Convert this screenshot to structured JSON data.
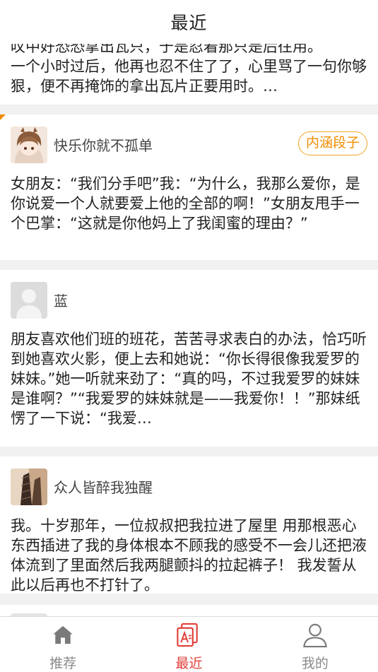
{
  "header": {
    "title": "最近"
  },
  "posts": [
    {
      "top_partial": "叹中好恐恐拿出瓦只，于是忍着那只是后往用。",
      "body": "一个小时过后，他再也忍不住了了，心里骂了一句你够狠，便不再掩饰的拿出瓦片正要用时。",
      "ellipsis": "…"
    },
    {
      "author": "快乐你就不孤单",
      "category": "内涵段子",
      "body": "女朋友：“我们分手吧”我：“为什么，我那么爱你，是你说爱一个人就要爱上他的全部的啊！”女朋友甩手一个巴掌：“这就是你他妈上了我闺蜜的理由？”"
    },
    {
      "author": "蓝",
      "body": "朋友喜欢他们班的班花，苦苦寻求表白的办法，恰巧听到她喜欢火影，便上去和她说：“你长得很像我爱罗的妹妹。”她一听就来劲了：“真的吗，不过我爱罗的妹妹是谁啊？”“我爱罗的妹妹就是——我爱你！！”那妹纸愣了一下说：“我爱…"
    },
    {
      "author": "众人皆醉我独醒",
      "body": "我。十岁那年，一位叔叔把我拉进了屋里 用那根恶心东西插进了我的身体根本不顾我的感受不一会儿还把液体流到了里面然后我两腿颤抖的拉起裤子！ 我发誓从此以后再也不打针了。"
    }
  ],
  "tabbar": {
    "tabs": [
      {
        "label": "推荐",
        "icon": "home-icon"
      },
      {
        "label": "最近",
        "icon": "recent-doc-icon",
        "active": true
      },
      {
        "label": "我的",
        "icon": "user-icon"
      }
    ]
  },
  "colors": {
    "accent": "#e0403a",
    "tag": "#f08c00",
    "separator": "#f1f1f1",
    "inactive": "#8a8a8a"
  }
}
